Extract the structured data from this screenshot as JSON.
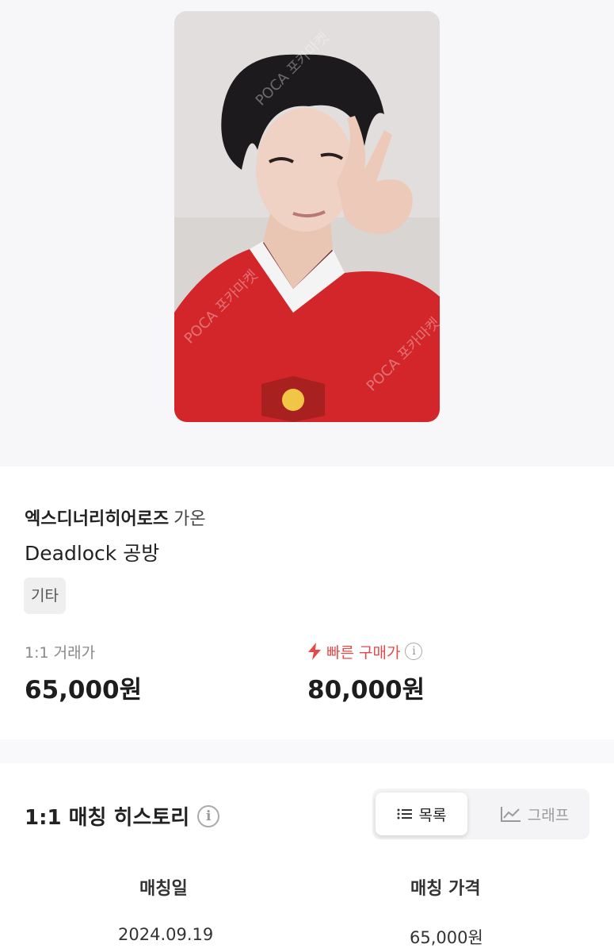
{
  "product": {
    "image_alt": "Photocard of member wearing red football jersey making V sign",
    "image_watermark": "POCA 포카마켓",
    "group_name": "엑스디너리히어로즈",
    "member_name": "가온",
    "album": "Deadlock 공방",
    "tag": "기타"
  },
  "prices": {
    "trade_label": "1:1 거래가",
    "trade_value": "65,000원",
    "fast_label": "빠른 구매가",
    "fast_value": "80,000원",
    "fast_icon": "lightning-icon",
    "info_glyph": "i"
  },
  "history": {
    "title": "1:1 매칭 히스토리",
    "info_glyph": "i",
    "view_list_label": "목록",
    "view_graph_label": "그래프",
    "active_view": "목록",
    "columns": [
      "매칭일",
      "매칭 가격"
    ],
    "rows": [
      {
        "date": "2024.09.19",
        "price": "65,000원"
      }
    ]
  },
  "colors": {
    "accent_red": "#e34a4a",
    "jersey_red": "#d3262b"
  }
}
